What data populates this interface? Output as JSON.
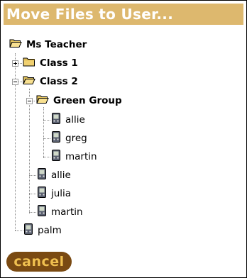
{
  "dialog": {
    "title": "Move Files to User..."
  },
  "tree": {
    "root": {
      "label": "Ms Teacher"
    },
    "class1": {
      "label": "Class 1"
    },
    "class2": {
      "label": "Class 2"
    },
    "green_group": {
      "label": "Green Group"
    },
    "gg_users": [
      "allie",
      "greg",
      "martin"
    ],
    "class2_users": [
      "allie",
      "julia",
      "martin"
    ],
    "palm": {
      "label": "palm"
    }
  },
  "buttons": {
    "cancel_label": "cancel"
  },
  "icons": {
    "folder": "folder-icon",
    "folder_open": "open-folder-icon",
    "device": "handheld-device-icon"
  },
  "colors": {
    "title_bg": "#ddb86e",
    "cancel_bg": "#7a4a12",
    "cancel_text": "#f0c050"
  }
}
